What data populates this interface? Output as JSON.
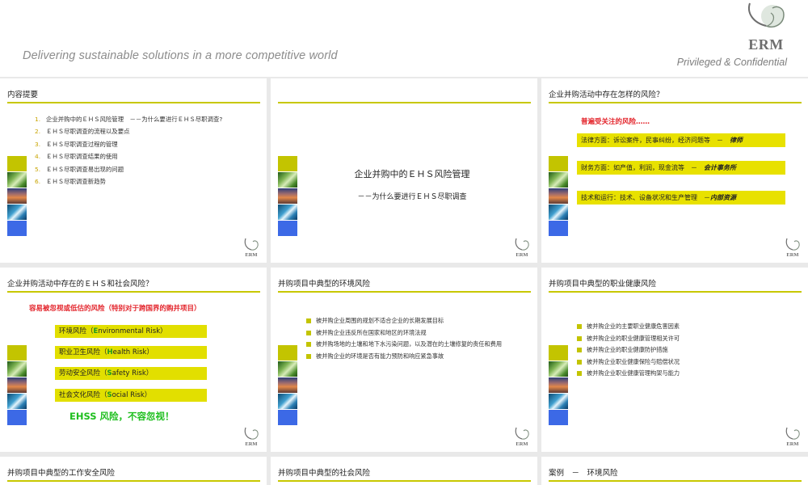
{
  "header": {
    "tagline": "Delivering sustainable solutions in a more competitive world",
    "confidential": "Privileged & Confidential",
    "logo_text": "ERM"
  },
  "colors": {
    "olive_accent": "#c8c800",
    "yellow_box": "#e8e100",
    "red_heading": "#e3242b",
    "green_text": "#1fbf1f",
    "blue_square": "#3c69e6"
  },
  "icons": [
    "erm-logo-icon",
    "photo-strip-icon",
    "bullet-square-icon"
  ],
  "slides": [
    {
      "title": "内容提要",
      "items": [
        {
          "num": "1.",
          "text": "企业并购中的ＥＨＳ风险管理　－－为什么要进行ＥＨＳ尽职调查?"
        },
        {
          "num": "2.",
          "text": "ＥＨＳ尽职调查的流程以及要点"
        },
        {
          "num": "3.",
          "text": "ＥＨＳ尽职调查过程的管理"
        },
        {
          "num": "4.",
          "text": "ＥＨＳ尽职调查结果的使用"
        },
        {
          "num": "5.",
          "text": "ＥＨＳ尽职调查易出现的问题"
        },
        {
          "num": "6.",
          "text": "ＥＨＳ尽职调查新趋势"
        }
      ]
    },
    {
      "title": "",
      "main_title": "企业并购中的ＥＨＳ风险管理",
      "subtitle": "－－为什么要进行ＥＨＳ尽职调查"
    },
    {
      "title": "企业并购活动中存在怎样的风险？",
      "heading": "普遍受关注的风险……",
      "rows": [
        {
          "text": "法律方面：诉讼案件，民事纠纷，经济问题等　－　",
          "role": "律师"
        },
        {
          "text": "财务方面：如产值，利润，现金流等　－　",
          "role": "会计事务所"
        },
        {
          "text": "技术和运行：技术、设备状况和生产管理　－",
          "role": "内部资源"
        }
      ]
    },
    {
      "title": "企业并购活动中存在的ＥＨＳ和社会风险？",
      "heading": "容易被忽视或低估的风险（特别对于跨国界的购并项目）",
      "risks": [
        {
          "cn": "环境风险（",
          "letter": "E",
          "en": "nvironmental Risk",
          "close": "）"
        },
        {
          "cn": "职业卫生风险（",
          "letter": "H",
          "en": "ealth Risk",
          "close": "）"
        },
        {
          "cn": "劳动安全风险（",
          "letter": "S",
          "en": "afety Risk",
          "close": "）"
        },
        {
          "cn": "社会文化风险（",
          "letter": "S",
          "en": "ocial Risk",
          "close": "）"
        }
      ],
      "footer": "EHSS 风险，不容忽视！"
    },
    {
      "title": "并购项目中典型的环境风险",
      "bullets": [
        "被并购企业周围的规划不适合企业的长期发展目标",
        "被并购企业违反所在国家和地区的环境法规",
        "被并购场地的土壤和地下水污染问题，以及潜在的土壤修复的责任和费用",
        "被并购企业的环境是否有能力预防和响应紧急事故"
      ]
    },
    {
      "title": "并购项目中典型的职业健康风险",
      "bullets": [
        "被并购企业的主要职业健康危害因素",
        "被并购企业的职业健康管理相关许可",
        "被并购企业的职业健康防护措施",
        "被并购企业职业健康保险与赔偿状况",
        "被并购企业职业健康管理构架与能力"
      ]
    },
    {
      "title": "并购项目中典型的工作安全风险"
    },
    {
      "title": "并购项目中典型的社会风险"
    },
    {
      "title": "案例　－　环境风险"
    }
  ]
}
